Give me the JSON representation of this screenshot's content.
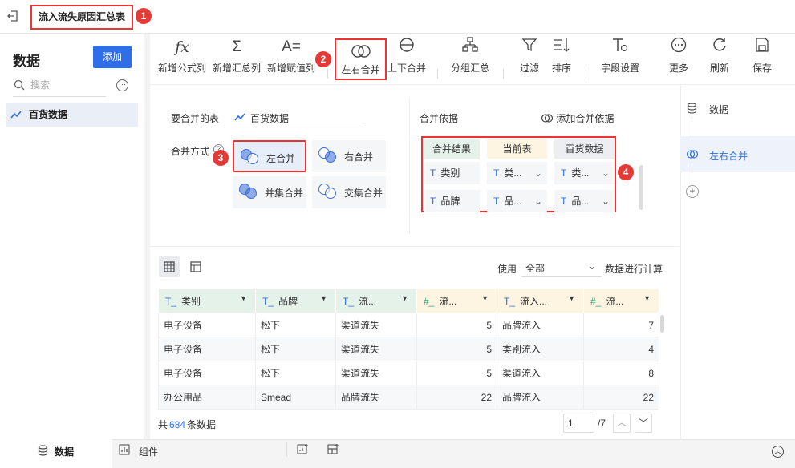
{
  "header": {
    "tab_title": "流入流失原因汇总表",
    "badge1": "1"
  },
  "left": {
    "title": "数据",
    "add_label": "添加",
    "search_placeholder": "搜索",
    "dataset": "百货数据"
  },
  "toolbar": {
    "items": [
      {
        "label": "新增公式列",
        "icon": "fx-icon"
      },
      {
        "label": "新增汇总列",
        "icon": "sigma-icon"
      },
      {
        "label": "新增赋值列",
        "icon": "assign-icon"
      },
      {
        "label": "左右合并",
        "icon": "venn-icon"
      },
      {
        "label": "上下合并",
        "icon": "stack-icon"
      },
      {
        "label": "分组汇总",
        "icon": "group-icon"
      },
      {
        "label": "过滤",
        "icon": "filter-icon"
      },
      {
        "label": "排序",
        "icon": "sort-icon"
      },
      {
        "label": "字段设置",
        "icon": "field-settings-icon"
      },
      {
        "label": "更多",
        "icon": "more-icon"
      },
      {
        "label": "刷新",
        "icon": "refresh-icon"
      },
      {
        "label": "保存",
        "icon": "save-icon"
      }
    ],
    "badge2": "2"
  },
  "config": {
    "merge_table_label": "要合并的表",
    "merge_table_value": "百货数据",
    "merge_method_label": "合并方式",
    "methods": [
      "左合并",
      "右合并",
      "并集合并",
      "交集合并"
    ],
    "badge3": "3",
    "basis_label": "合并依据",
    "add_basis": "添加合并依据",
    "map_headers": [
      "合并结果",
      "当前表",
      "百货数据"
    ],
    "map_rows": [
      [
        "类别",
        "类...",
        "类..."
      ],
      [
        "品牌",
        "品...",
        "品..."
      ]
    ],
    "badge4": "4"
  },
  "data": {
    "use_label": "使用",
    "use_value": "全部",
    "calc_label": "数据进行计算",
    "columns": [
      "类别",
      "品牌",
      "流...",
      "流...",
      "流入...",
      "流..."
    ],
    "rows": [
      [
        "电子设备",
        "松下",
        "渠道流失",
        "5",
        "品牌流入",
        "7"
      ],
      [
        "电子设备",
        "松下",
        "渠道流失",
        "5",
        "类别流入",
        "4"
      ],
      [
        "电子设备",
        "松下",
        "渠道流失",
        "5",
        "渠道流入",
        "8"
      ],
      [
        "办公用品",
        "Smead",
        "品牌流失",
        "22",
        "品牌流入",
        "22"
      ]
    ],
    "total_prefix": "共",
    "total_count": "684",
    "total_suffix": "条数据",
    "page_current": "1",
    "page_total": "/7"
  },
  "right": {
    "items": [
      "数据",
      "左右合并"
    ]
  },
  "bottom": {
    "tabs": [
      "数据",
      "组件"
    ]
  },
  "colors": {
    "accent": "#2f6ee8",
    "highlight": "#e33333",
    "badge": "#e53935"
  }
}
